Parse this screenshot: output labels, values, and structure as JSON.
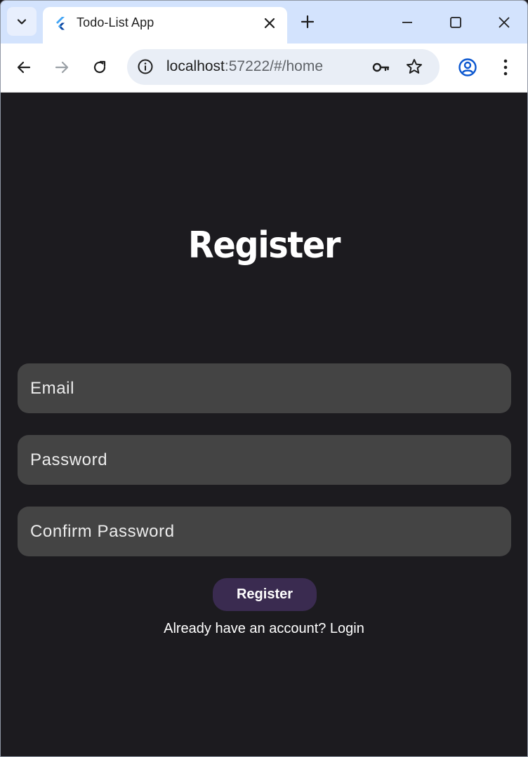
{
  "browser": {
    "tab": {
      "title": "Todo-List App",
      "favicon": "flutter-logo-icon"
    },
    "address_bar": {
      "host": "localhost",
      "rest": ":57222/#/home"
    },
    "icons": {
      "tab_search": "chevron-down-icon",
      "tab_close": "close-icon",
      "new_tab": "plus-icon",
      "minimize": "minimize-icon",
      "maximize": "maximize-icon",
      "window_close": "close-icon",
      "back": "arrow-left-icon",
      "forward": "arrow-right-icon",
      "reload": "reload-icon",
      "site_info": "info-icon",
      "password_key": "key-icon",
      "bookmark": "star-icon",
      "profile": "profile-icon",
      "menu": "kebab-menu-icon"
    }
  },
  "register_page": {
    "title": "Register",
    "fields": {
      "email": {
        "placeholder": "Email",
        "value": ""
      },
      "password": {
        "placeholder": "Password",
        "value": ""
      },
      "confirm_password": {
        "placeholder": "Confirm Password",
        "value": ""
      }
    },
    "submit_label": "Register",
    "login_prompt": "Already have an account? Login"
  },
  "colors": {
    "page_background": "#1c1b1f",
    "field_background": "#444444",
    "button_background": "#3a2b50",
    "tabstrip_background": "#d3e3fd"
  }
}
